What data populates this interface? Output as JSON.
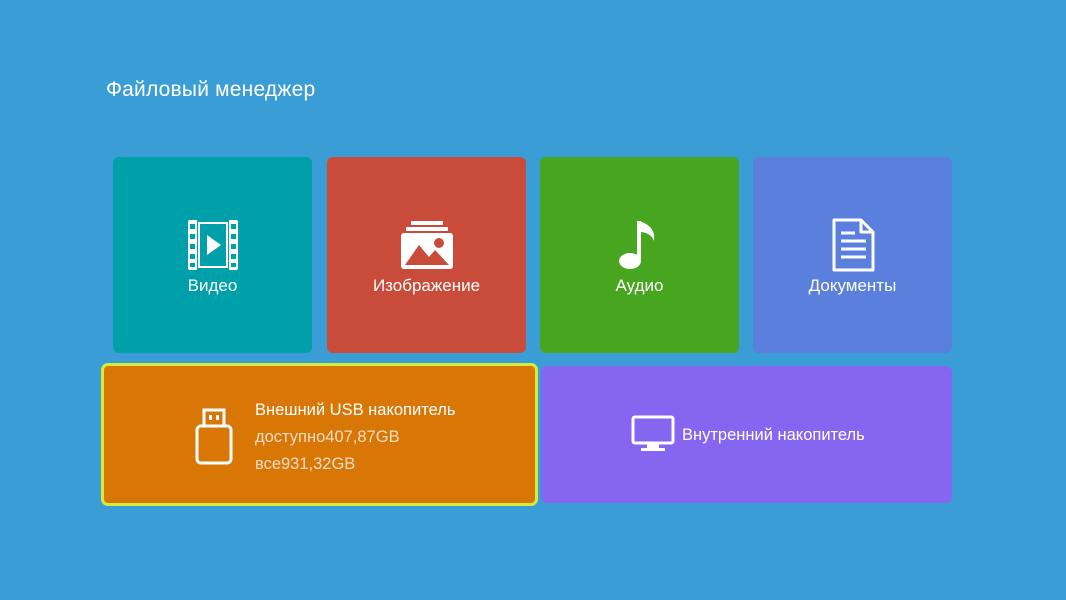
{
  "header": {
    "title": "Файловый менеджер"
  },
  "tiles": {
    "video": {
      "label": "Видео",
      "icon": "film-play-icon"
    },
    "image": {
      "label": "Изображение",
      "icon": "picture-stack-icon"
    },
    "audio": {
      "label": "Аудио",
      "icon": "music-note-icon"
    },
    "docs": {
      "label": "Документы",
      "icon": "document-icon"
    }
  },
  "storage": {
    "usb": {
      "title": "Внешний USB накопитель",
      "available": "доступно407,87GB",
      "total": "все931,32GB",
      "icon": "usb-drive-icon",
      "selected": true
    },
    "internal": {
      "label": "Внутренний накопитель",
      "icon": "monitor-icon"
    }
  },
  "colors": {
    "background": "#3a9dd6",
    "video": "#00a0aa",
    "image": "#c94c3a",
    "audio": "#48a51f",
    "docs": "#5b7fdd",
    "usb": "#d87706",
    "focus_border": "#d6ea3b",
    "internal": "#8666f0"
  }
}
